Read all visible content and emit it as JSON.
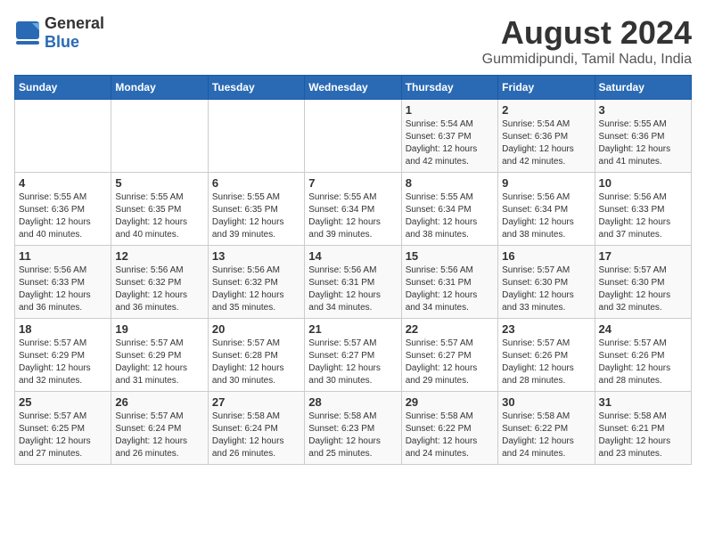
{
  "logo": {
    "text_general": "General",
    "text_blue": "Blue"
  },
  "title": "August 2024",
  "subtitle": "Gummidipundi, Tamil Nadu, India",
  "headers": [
    "Sunday",
    "Monday",
    "Tuesday",
    "Wednesday",
    "Thursday",
    "Friday",
    "Saturday"
  ],
  "weeks": [
    [
      {
        "day": "",
        "info": ""
      },
      {
        "day": "",
        "info": ""
      },
      {
        "day": "",
        "info": ""
      },
      {
        "day": "",
        "info": ""
      },
      {
        "day": "1",
        "info": "Sunrise: 5:54 AM\nSunset: 6:37 PM\nDaylight: 12 hours and 42 minutes."
      },
      {
        "day": "2",
        "info": "Sunrise: 5:54 AM\nSunset: 6:36 PM\nDaylight: 12 hours and 42 minutes."
      },
      {
        "day": "3",
        "info": "Sunrise: 5:55 AM\nSunset: 6:36 PM\nDaylight: 12 hours and 41 minutes."
      }
    ],
    [
      {
        "day": "4",
        "info": "Sunrise: 5:55 AM\nSunset: 6:36 PM\nDaylight: 12 hours and 40 minutes."
      },
      {
        "day": "5",
        "info": "Sunrise: 5:55 AM\nSunset: 6:35 PM\nDaylight: 12 hours and 40 minutes."
      },
      {
        "day": "6",
        "info": "Sunrise: 5:55 AM\nSunset: 6:35 PM\nDaylight: 12 hours and 39 minutes."
      },
      {
        "day": "7",
        "info": "Sunrise: 5:55 AM\nSunset: 6:34 PM\nDaylight: 12 hours and 39 minutes."
      },
      {
        "day": "8",
        "info": "Sunrise: 5:55 AM\nSunset: 6:34 PM\nDaylight: 12 hours and 38 minutes."
      },
      {
        "day": "9",
        "info": "Sunrise: 5:56 AM\nSunset: 6:34 PM\nDaylight: 12 hours and 38 minutes."
      },
      {
        "day": "10",
        "info": "Sunrise: 5:56 AM\nSunset: 6:33 PM\nDaylight: 12 hours and 37 minutes."
      }
    ],
    [
      {
        "day": "11",
        "info": "Sunrise: 5:56 AM\nSunset: 6:33 PM\nDaylight: 12 hours and 36 minutes."
      },
      {
        "day": "12",
        "info": "Sunrise: 5:56 AM\nSunset: 6:32 PM\nDaylight: 12 hours and 36 minutes."
      },
      {
        "day": "13",
        "info": "Sunrise: 5:56 AM\nSunset: 6:32 PM\nDaylight: 12 hours and 35 minutes."
      },
      {
        "day": "14",
        "info": "Sunrise: 5:56 AM\nSunset: 6:31 PM\nDaylight: 12 hours and 34 minutes."
      },
      {
        "day": "15",
        "info": "Sunrise: 5:56 AM\nSunset: 6:31 PM\nDaylight: 12 hours and 34 minutes."
      },
      {
        "day": "16",
        "info": "Sunrise: 5:57 AM\nSunset: 6:30 PM\nDaylight: 12 hours and 33 minutes."
      },
      {
        "day": "17",
        "info": "Sunrise: 5:57 AM\nSunset: 6:30 PM\nDaylight: 12 hours and 32 minutes."
      }
    ],
    [
      {
        "day": "18",
        "info": "Sunrise: 5:57 AM\nSunset: 6:29 PM\nDaylight: 12 hours and 32 minutes."
      },
      {
        "day": "19",
        "info": "Sunrise: 5:57 AM\nSunset: 6:29 PM\nDaylight: 12 hours and 31 minutes."
      },
      {
        "day": "20",
        "info": "Sunrise: 5:57 AM\nSunset: 6:28 PM\nDaylight: 12 hours and 30 minutes."
      },
      {
        "day": "21",
        "info": "Sunrise: 5:57 AM\nSunset: 6:27 PM\nDaylight: 12 hours and 30 minutes."
      },
      {
        "day": "22",
        "info": "Sunrise: 5:57 AM\nSunset: 6:27 PM\nDaylight: 12 hours and 29 minutes."
      },
      {
        "day": "23",
        "info": "Sunrise: 5:57 AM\nSunset: 6:26 PM\nDaylight: 12 hours and 28 minutes."
      },
      {
        "day": "24",
        "info": "Sunrise: 5:57 AM\nSunset: 6:26 PM\nDaylight: 12 hours and 28 minutes."
      }
    ],
    [
      {
        "day": "25",
        "info": "Sunrise: 5:57 AM\nSunset: 6:25 PM\nDaylight: 12 hours and 27 minutes."
      },
      {
        "day": "26",
        "info": "Sunrise: 5:57 AM\nSunset: 6:24 PM\nDaylight: 12 hours and 26 minutes."
      },
      {
        "day": "27",
        "info": "Sunrise: 5:58 AM\nSunset: 6:24 PM\nDaylight: 12 hours and 26 minutes."
      },
      {
        "day": "28",
        "info": "Sunrise: 5:58 AM\nSunset: 6:23 PM\nDaylight: 12 hours and 25 minutes."
      },
      {
        "day": "29",
        "info": "Sunrise: 5:58 AM\nSunset: 6:22 PM\nDaylight: 12 hours and 24 minutes."
      },
      {
        "day": "30",
        "info": "Sunrise: 5:58 AM\nSunset: 6:22 PM\nDaylight: 12 hours and 24 minutes."
      },
      {
        "day": "31",
        "info": "Sunrise: 5:58 AM\nSunset: 6:21 PM\nDaylight: 12 hours and 23 minutes."
      }
    ]
  ]
}
